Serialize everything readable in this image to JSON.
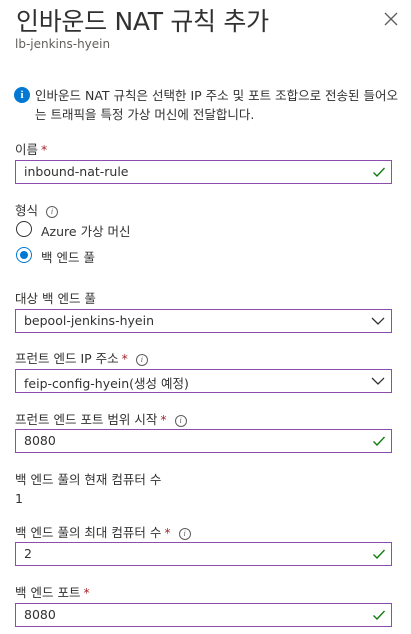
{
  "header": {
    "title": "인바운드 NAT 규칙 추가",
    "subtitle": "lb-jenkins-hyein"
  },
  "info": {
    "text": "인바운드 NAT 규칙은 선택한 IP 주소 및 포트 조합으로 전송된 들어오는 트래픽을 특정 가상 머신에 전달합니다."
  },
  "name": {
    "label": "이름",
    "value": "inbound-nat-rule"
  },
  "type": {
    "label": "형식",
    "options": [
      "Azure 가상 머신",
      "백 엔드 풀"
    ],
    "selected": "백 엔드 풀"
  },
  "backend_pool": {
    "label": "대상 백 엔드 풀",
    "value": "bepool-jenkins-hyein"
  },
  "frontend_ip": {
    "label": "프런트 엔드 IP 주소",
    "value": "feip-config-hyein(생성 예정)"
  },
  "frontend_port_start": {
    "label": "프런트 엔드 포트 범위 시작",
    "value": "8080"
  },
  "current_count": {
    "label": "백 엔드 풀의 현재 컴퓨터 수",
    "value": "1"
  },
  "max_count": {
    "label": "백 엔드 풀의 최대 컴퓨터 수",
    "value": "2"
  },
  "backend_port": {
    "label": "백 엔드 포트",
    "value": "8080"
  },
  "required_marker": "*",
  "colors": {
    "accent": "#0078d4",
    "field_border": "#8a4fad",
    "check": "#107c10",
    "required": "#a4262c"
  }
}
